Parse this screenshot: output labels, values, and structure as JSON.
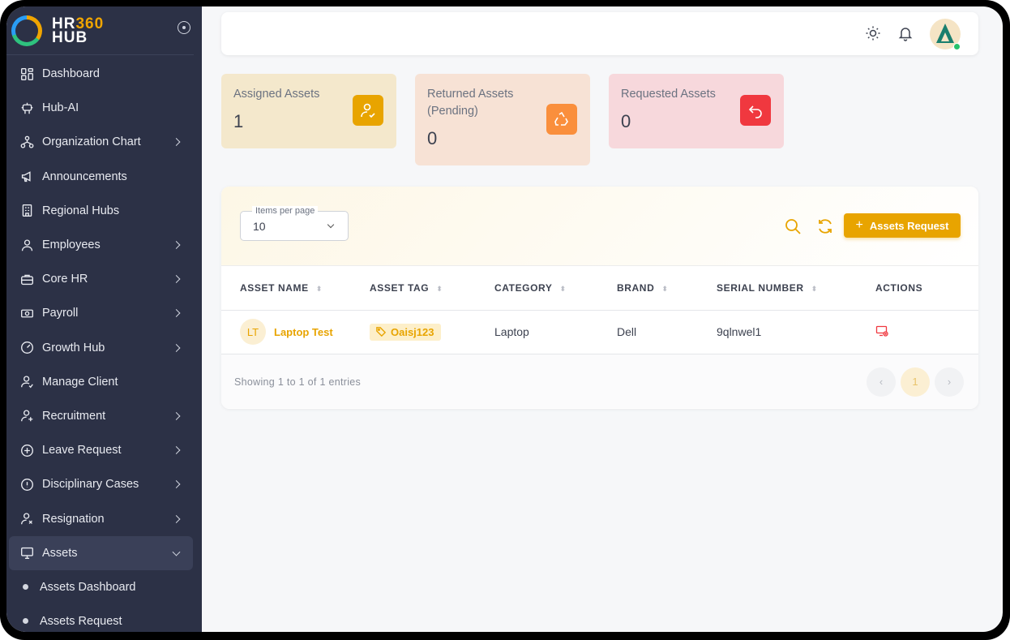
{
  "brand": {
    "line1a": "HR",
    "line1b": "360",
    "line2": "HUB"
  },
  "sidebar": {
    "items": [
      {
        "label": "Dashboard"
      },
      {
        "label": "Hub-AI"
      },
      {
        "label": "Organization Chart"
      },
      {
        "label": "Announcements"
      },
      {
        "label": "Regional Hubs"
      },
      {
        "label": "Employees"
      },
      {
        "label": "Core HR"
      },
      {
        "label": "Payroll"
      },
      {
        "label": "Growth Hub"
      },
      {
        "label": "Manage Client"
      },
      {
        "label": "Recruitment"
      },
      {
        "label": "Leave Request"
      },
      {
        "label": "Disciplinary Cases"
      },
      {
        "label": "Resignation"
      },
      {
        "label": "Assets"
      }
    ],
    "sub_items": [
      {
        "label": "Assets Dashboard"
      },
      {
        "label": "Assets Request"
      }
    ]
  },
  "stats": {
    "assigned": {
      "label": "Assigned Assets",
      "value": "1"
    },
    "returned": {
      "label": "Returned Assets (Pending)",
      "value": "0"
    },
    "requested": {
      "label": "Requested Assets",
      "value": "0"
    }
  },
  "table": {
    "items_per_page_label": "Items per page",
    "items_per_page_value": "10",
    "request_button": "Assets Request",
    "columns": [
      "ASSET NAME",
      "ASSET TAG",
      "CATEGORY",
      "BRAND",
      "SERIAL NUMBER",
      "ACTIONS"
    ],
    "rows": [
      {
        "initials": "LT",
        "name": "Laptop Test",
        "tag": "Oaisj123",
        "category": "Laptop",
        "brand": "Dell",
        "serial": "9qlnwel1"
      }
    ],
    "showing": "Showing 1 to 1 of 1 entries",
    "page": "1"
  },
  "colors": {
    "accent": "#e8a400",
    "sidebar": "#2c3146",
    "danger": "#f0383f",
    "orange": "#fa8f3c"
  }
}
